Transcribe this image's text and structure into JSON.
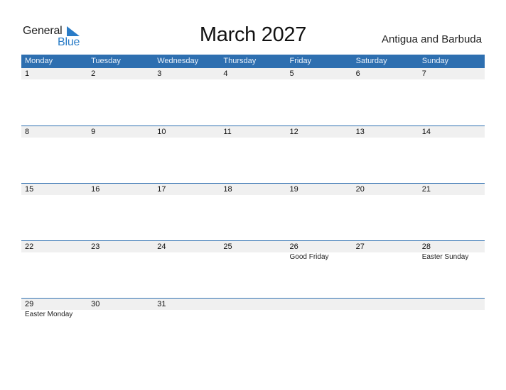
{
  "logo": {
    "general": "General",
    "blue": "Blue"
  },
  "title": "March 2027",
  "country": "Antigua and Barbuda",
  "colors": {
    "header_bg": "#2e6fb0",
    "header_text": "#e8f0fa",
    "date_strip": "#f0f0f0",
    "logo_blue": "#2a7cc7"
  },
  "weekdays": [
    "Monday",
    "Tuesday",
    "Wednesday",
    "Thursday",
    "Friday",
    "Saturday",
    "Sunday"
  ],
  "weeks": [
    [
      {
        "day": "1",
        "holiday": ""
      },
      {
        "day": "2",
        "holiday": ""
      },
      {
        "day": "3",
        "holiday": ""
      },
      {
        "day": "4",
        "holiday": ""
      },
      {
        "day": "5",
        "holiday": ""
      },
      {
        "day": "6",
        "holiday": ""
      },
      {
        "day": "7",
        "holiday": ""
      }
    ],
    [
      {
        "day": "8",
        "holiday": ""
      },
      {
        "day": "9",
        "holiday": ""
      },
      {
        "day": "10",
        "holiday": ""
      },
      {
        "day": "11",
        "holiday": ""
      },
      {
        "day": "12",
        "holiday": ""
      },
      {
        "day": "13",
        "holiday": ""
      },
      {
        "day": "14",
        "holiday": ""
      }
    ],
    [
      {
        "day": "15",
        "holiday": ""
      },
      {
        "day": "16",
        "holiday": ""
      },
      {
        "day": "17",
        "holiday": ""
      },
      {
        "day": "18",
        "holiday": ""
      },
      {
        "day": "19",
        "holiday": ""
      },
      {
        "day": "20",
        "holiday": ""
      },
      {
        "day": "21",
        "holiday": ""
      }
    ],
    [
      {
        "day": "22",
        "holiday": ""
      },
      {
        "day": "23",
        "holiday": ""
      },
      {
        "day": "24",
        "holiday": ""
      },
      {
        "day": "25",
        "holiday": ""
      },
      {
        "day": "26",
        "holiday": "Good Friday"
      },
      {
        "day": "27",
        "holiday": ""
      },
      {
        "day": "28",
        "holiday": "Easter Sunday"
      }
    ],
    [
      {
        "day": "29",
        "holiday": "Easter Monday"
      },
      {
        "day": "30",
        "holiday": ""
      },
      {
        "day": "31",
        "holiday": ""
      },
      {
        "day": "",
        "holiday": ""
      },
      {
        "day": "",
        "holiday": ""
      },
      {
        "day": "",
        "holiday": ""
      },
      {
        "day": "",
        "holiday": ""
      }
    ]
  ]
}
